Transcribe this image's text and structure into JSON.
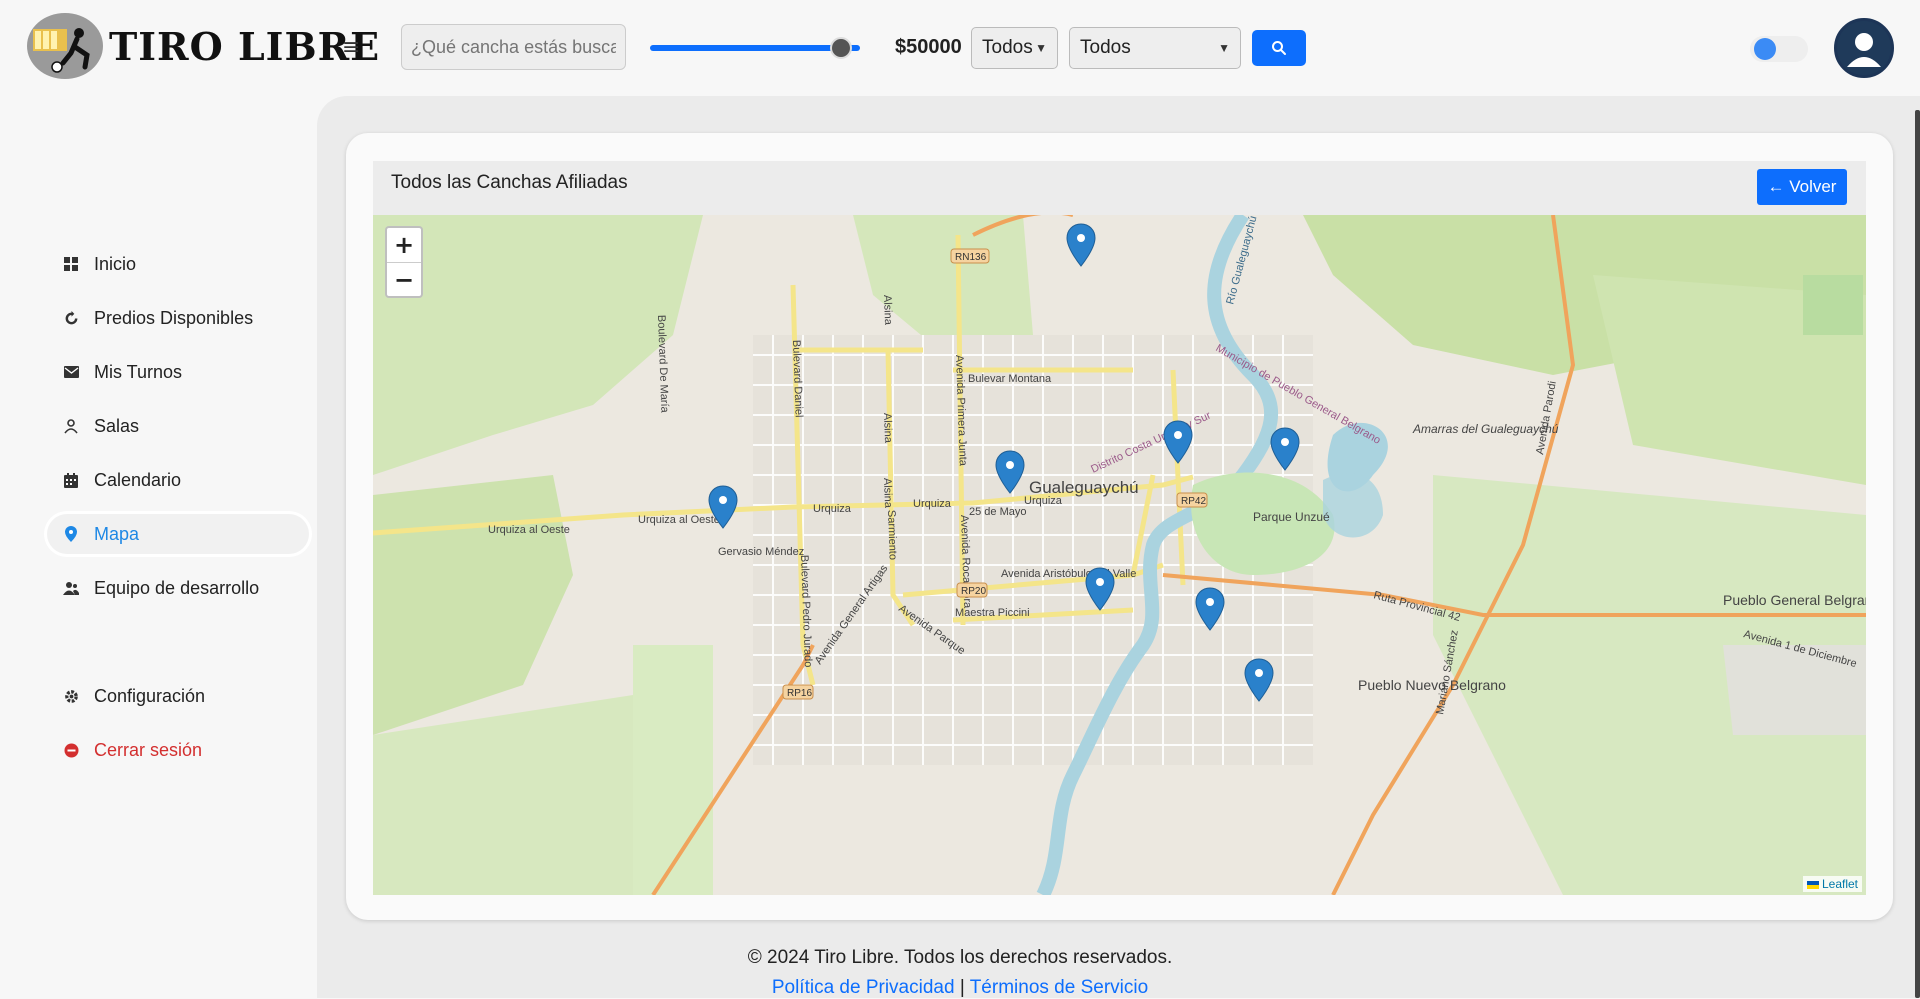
{
  "brand": {
    "name": "TIRO LIBRE"
  },
  "header": {
    "search_placeholder": "¿Qué cancha estás buscando?",
    "price_value": "$50000",
    "price_slider_fraction": 0.96,
    "filter_1": "Todos",
    "filter_2": "Todos"
  },
  "sidebar": {
    "items": [
      {
        "label": "Inicio",
        "icon": "grid-icon"
      },
      {
        "label": "Predios Disponibles",
        "icon": "refresh-icon"
      },
      {
        "label": "Mis Turnos",
        "icon": "envelope-icon"
      },
      {
        "label": "Salas",
        "icon": "user-icon"
      },
      {
        "label": "Calendario",
        "icon": "calendar-icon"
      },
      {
        "label": "Mapa",
        "icon": "map-pin-icon",
        "active": true
      },
      {
        "label": "Equipo de desarrollo",
        "icon": "team-icon"
      }
    ],
    "bottom": [
      {
        "label": "Configuración",
        "icon": "gear-icon"
      },
      {
        "label": "Cerrar sesión",
        "icon": "logout-icon"
      }
    ]
  },
  "card": {
    "title": "Todos las Canchas Afiliadas",
    "back_label": "← Volver"
  },
  "map": {
    "zoom_in": "+",
    "zoom_out": "−",
    "attribution": "Leaflet",
    "labels": [
      "Gualeguaychú",
      "Bulevar Montana",
      "Urquiza al Oeste",
      "Urquiza",
      "25 de Mayo",
      "Avenida Aristóbulo del Valle",
      "Gervasio Méndez",
      "Boulevard De María",
      "Bulevard Daniel",
      "Avenida Primera Junta",
      "Alsina",
      "Sarmiento",
      "Avenida General Artigas",
      "Avenida Parque",
      "Maestra Piccini",
      "Amarras del Gualeguaychú",
      "Parque Unzué",
      "Pueblo General Belgrano",
      "Pueblo Nuevo Belgrano",
      "Ruta Provincial 42",
      "Avenida 1 de Diciembre",
      "Mariano Sánchez",
      "Bulevard Pedro Jurado",
      "Río Gualeguaychú",
      "Municipio de Pueblo General Belgrano",
      "Distrito Costa Uruguay Sur",
      "Avenida Rocamora",
      "Avenida Parodi",
      "RN136",
      "RP42",
      "RP16",
      "RP20"
    ]
  },
  "footer": {
    "copyright": "© 2024 Tiro Libre. Todos los derechos reservados.",
    "privacy": "Política de Privacidad",
    "separator": "|",
    "terms": "Términos de Servicio"
  },
  "colors": {
    "accent": "#0d6efd",
    "danger": "#d32f2f",
    "active_link": "#1e88e5"
  }
}
